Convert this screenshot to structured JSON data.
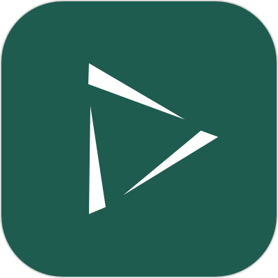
{
  "icon": {
    "name": "play-triangle-app-icon",
    "colors": {
      "background": "#1d5c4f",
      "glyph": "#ffffff",
      "page": "#ffffff"
    }
  }
}
